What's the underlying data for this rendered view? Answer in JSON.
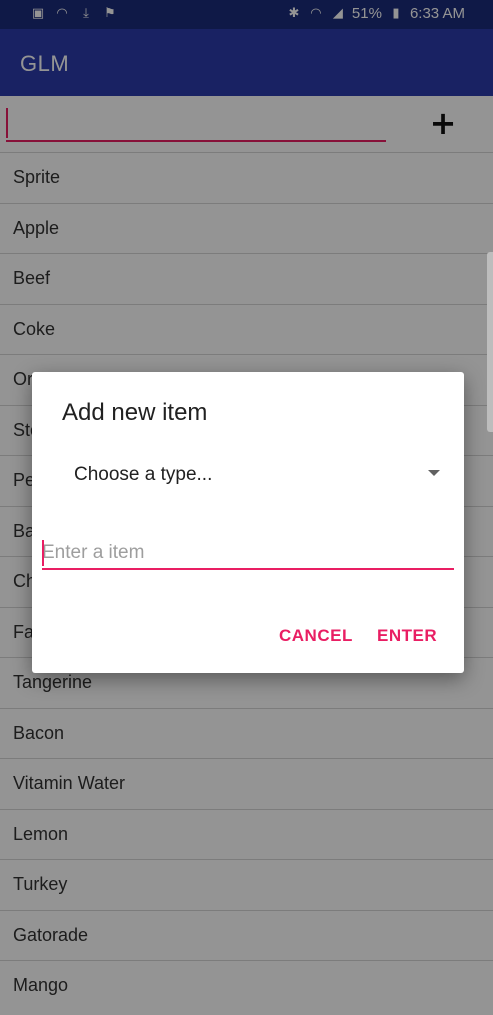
{
  "status_bar": {
    "left_icons": [
      "image-icon",
      "wifi-icon",
      "download-icon",
      "flag-icon"
    ],
    "battery": "51%",
    "time": "6:33 AM"
  },
  "app_bar": {
    "title": "GLM"
  },
  "main_input": {
    "value": "",
    "placeholder": ""
  },
  "add_button": {
    "label": "+"
  },
  "list": {
    "items": [
      "Sprite",
      "Apple",
      "Beef",
      "Coke",
      "Or",
      "Ste",
      "Pe",
      "Ba",
      "Ch",
      "Fa",
      "Tangerine",
      "Bacon",
      "Vitamin Water",
      "Lemon",
      "Turkey",
      "Gatorade",
      "Mango"
    ]
  },
  "dialog": {
    "title": "Add new item",
    "spinner_selected": "Choose a type...",
    "input_placeholder": "Enter a item",
    "input_value": "",
    "cancel_label": "CANCEL",
    "enter_label": "ENTER"
  },
  "colors": {
    "status_bar": "#1b2b7a",
    "app_bar": "#2b3cab",
    "accent": "#e91e63"
  }
}
